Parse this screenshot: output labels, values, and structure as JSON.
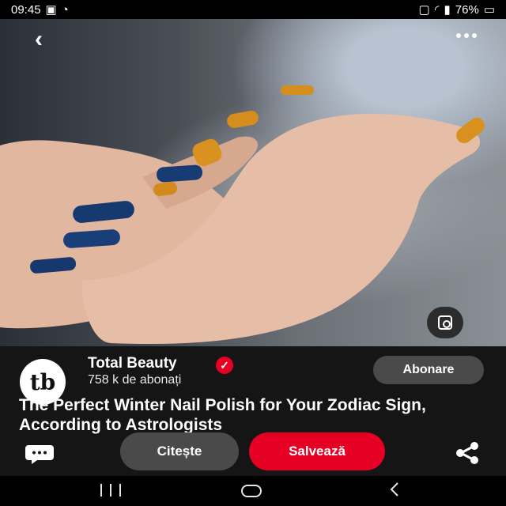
{
  "status": {
    "time": "09:45",
    "battery": "76%"
  },
  "account": {
    "logo_text": "tb",
    "name": "Total Beauty",
    "followers": "758 k de abonați"
  },
  "buttons": {
    "follow": "Abonare",
    "read": "Citește",
    "save": "Salvează"
  },
  "pin": {
    "title": "The Perfect Winter Nail Polish for Your Zodiac Sign, According to Astrologists"
  },
  "icons": {
    "back": "back-icon",
    "more": "more-icon",
    "lens": "visual-search-icon",
    "comment": "comment-icon",
    "share": "share-icon"
  }
}
